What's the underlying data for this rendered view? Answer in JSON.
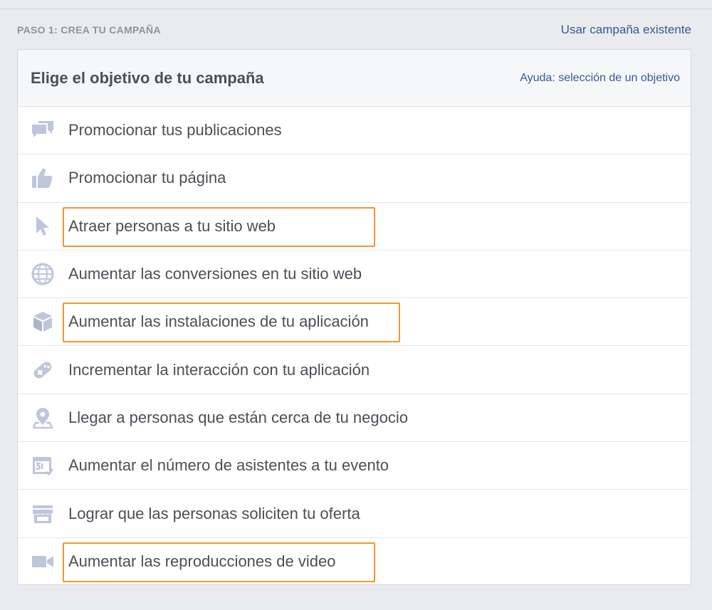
{
  "step": {
    "title": "PASO 1: CREA TU CAMPAÑA",
    "existing_campaign_link": "Usar campaña existente"
  },
  "card": {
    "title": "Elige el objetivo de tu campaña",
    "help_link": "Ayuda: selección de un objetivo"
  },
  "objectives": [
    {
      "label": "Promocionar tus publicaciones",
      "icon": "speech-bubbles-icon",
      "highlighted": false
    },
    {
      "label": "Promocionar tu página",
      "icon": "thumbs-up-icon",
      "highlighted": false
    },
    {
      "label": "Atraer personas a tu sitio web",
      "icon": "cursor-icon",
      "highlighted": true
    },
    {
      "label": "Aumentar las conversiones en tu sitio web",
      "icon": "globe-icon",
      "highlighted": false
    },
    {
      "label": "Aumentar las instalaciones de tu aplicación",
      "icon": "box-icon",
      "highlighted": true
    },
    {
      "label": "Incrementar la interacción con tu aplicación",
      "icon": "gamepad-icon",
      "highlighted": false
    },
    {
      "label": "Llegar a personas que están cerca de tu negocio",
      "icon": "location-pin-icon",
      "highlighted": false
    },
    {
      "label": "Aumentar el número de asistentes a tu evento",
      "icon": "calendar-icon",
      "highlighted": false
    },
    {
      "label": "Lograr que las personas soliciten tu oferta",
      "icon": "storefront-icon",
      "highlighted": false
    },
    {
      "label": "Aumentar las reproducciones de video",
      "icon": "video-camera-icon",
      "highlighted": true
    }
  ],
  "colors": {
    "background": "#e9ebee",
    "link": "#365899",
    "highlight_border": "#f0962e",
    "icon": "#bec6d9",
    "text": "#4b4f56"
  }
}
